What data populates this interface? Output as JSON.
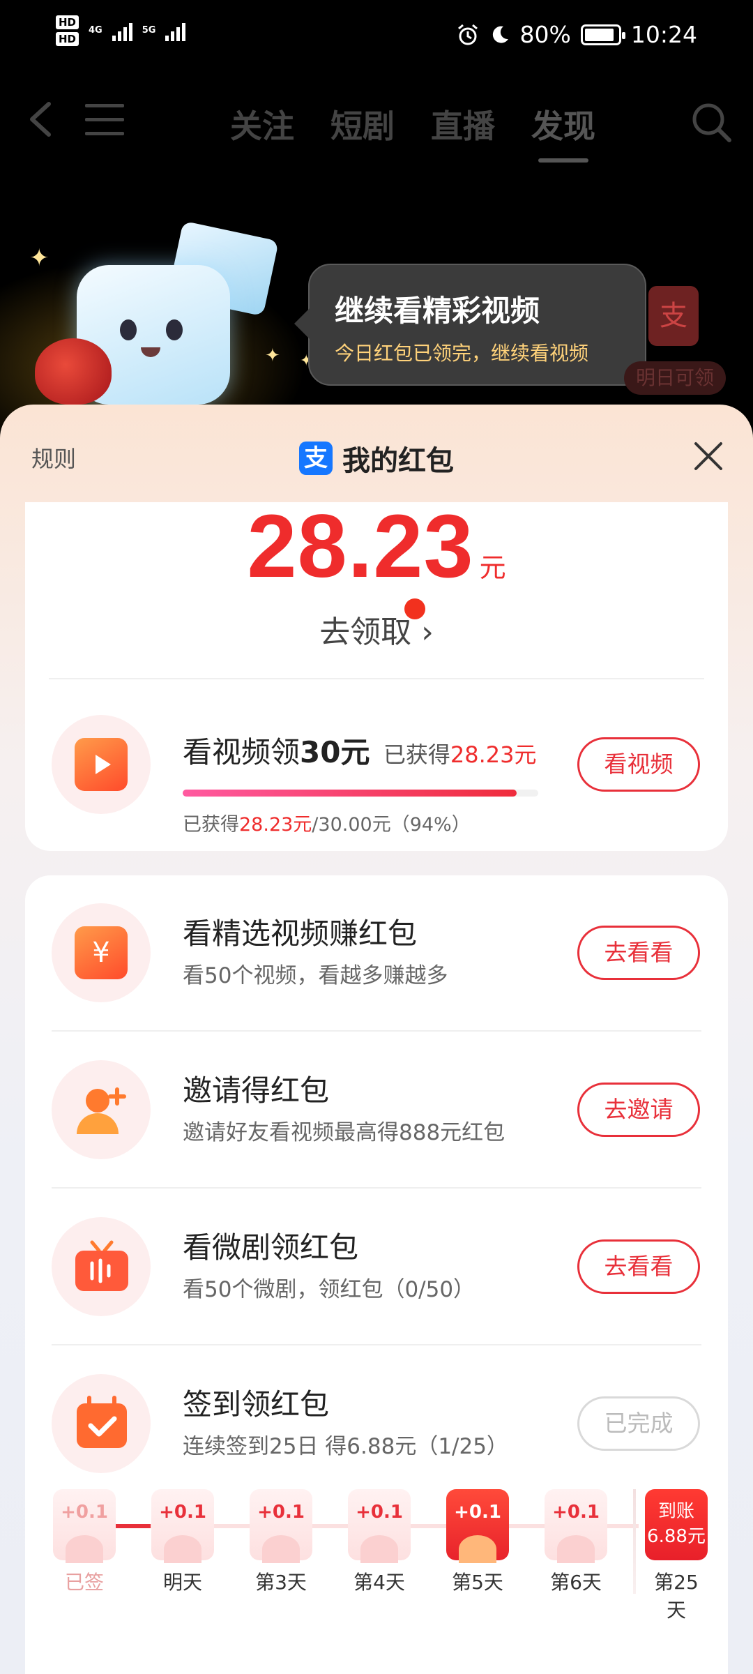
{
  "status_bar": {
    "hd1": "HD",
    "hd2": "HD",
    "net1": "4G",
    "net2": "5G",
    "battery": "80%",
    "time": "10:24"
  },
  "nav": {
    "tabs": [
      "关注",
      "短剧",
      "直播",
      "发现"
    ],
    "active_tab": "发现"
  },
  "banner": {
    "title": "继续看精彩视频",
    "subtitle": "今日红包已领完，继续看视频",
    "badge_icon": "支",
    "tomorrow": "明日可领"
  },
  "sheet": {
    "rules": "规则",
    "logo": "支",
    "title": "我的红包",
    "balance": "28.23",
    "unit": "元",
    "claim": "去领取",
    "claim_chevron": "›"
  },
  "video_task": {
    "title_pre": "看视频领",
    "title_amount": "30元",
    "earned_label": "已获得",
    "earned_value": "28.23元",
    "progress_pct": 94,
    "progress_label_pre": "已获得",
    "progress_value": "28.23元",
    "progress_label_post": "/30.00元（94%）",
    "button": "看视频"
  },
  "tasks": [
    {
      "title": "看精选视频赚红包",
      "sub": "看50个视频，看越多赚越多",
      "button": "去看看",
      "icon": "¥"
    },
    {
      "title": "邀请得红包",
      "sub": "邀请好友看视频最高得888元红包",
      "button": "去邀请",
      "icon": "user-plus"
    },
    {
      "title": "看微剧领红包",
      "sub": "看50个微剧，领红包（0/50）",
      "button": "去看看",
      "icon": "tv"
    },
    {
      "title": "签到领红包",
      "sub": "连续签到25日 得6.88元（1/25）",
      "button": "已完成",
      "icon": "calendar-check"
    }
  ],
  "checkin": {
    "days": [
      {
        "amount": "+0.1",
        "label": "已签"
      },
      {
        "amount": "+0.1",
        "label": "明天"
      },
      {
        "amount": "+0.1",
        "label": "第3天"
      },
      {
        "amount": "+0.1",
        "label": "第4天"
      },
      {
        "amount": "+0.1",
        "label": "第5天"
      },
      {
        "amount": "+0.1",
        "label": "第6天"
      }
    ],
    "final": {
      "line1": "到账",
      "line2": "6.88元",
      "label": "第25天"
    }
  },
  "colors": {
    "accent": "#e8303a",
    "balance": "#ef2c2c",
    "alipay": "#1677ff"
  }
}
